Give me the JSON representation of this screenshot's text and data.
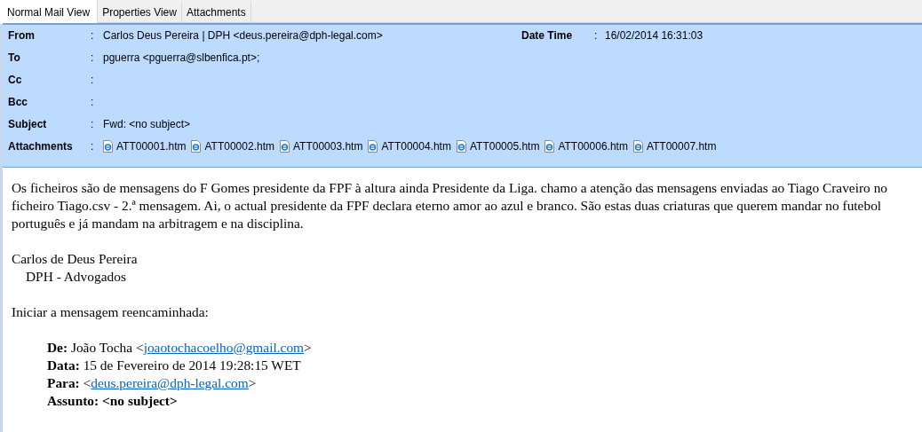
{
  "tabs": [
    {
      "label": "Normal Mail View",
      "selected": true
    },
    {
      "label": "Properties View",
      "selected": false
    },
    {
      "label": "Attachments",
      "selected": false
    }
  ],
  "header": {
    "fields": [
      {
        "kind": "text",
        "label": "From",
        "separator": ":",
        "value": "Carlos Deus Pereira | DPH <deus.pereira@dph-legal.com>"
      },
      {
        "kind": "text",
        "label": "To",
        "separator": ":",
        "value": "pguerra <pguerra@slbenfica.pt>;"
      },
      {
        "kind": "text",
        "label": "Cc",
        "separator": ":"
      },
      {
        "kind": "text",
        "label": "Bcc",
        "separator": ":"
      },
      {
        "kind": "text",
        "label": "Subject",
        "separator": ":",
        "value": "Fwd: <no subject>"
      },
      {
        "kind": "files",
        "label": "Attachments",
        "separator": ":",
        "files": [
          "ATT00001.htm",
          "ATT00002.htm",
          "ATT00003.htm",
          "ATT00004.htm",
          "ATT00005.htm",
          "ATT00006.htm",
          "ATT00007.htm"
        ]
      }
    ],
    "date_time": {
      "label": "Date Time",
      "separator": ":",
      "value": "16/02/2014 16:31:03"
    }
  },
  "body": {
    "paragraphs": [
      "Os ficheiros são de mensagens do F Gomes presidente da FPF à altura ainda Presidente da Liga. chamo a atenção das mensagens enviadas ao Tiago Craveiro no ficheiro Tiago.csv - 2.ª mensagem. Ai, o actual presidente da FPF declara eterno amor ao azul e branco. São estas duas criaturas que querem mandar no futebol português e já mandam na arbitragem e na disciplina."
    ],
    "signature": [
      "Carlos de Deus Pereira",
      "DPH - Advogados"
    ],
    "forward_intro": "Iniciar a mensagem reencaminhada:",
    "forwarded_headers": [
      {
        "label": "De:",
        "bold": false,
        "value": "João Tocha <",
        "link": "joaotochacoelho@gmail.com",
        "after": ">"
      },
      {
        "label": "Data:",
        "bold": false,
        "value": "15 de Fevereiro de 2014 19:28:15 WET"
      },
      {
        "label": "Para:",
        "bold": false,
        "value": "<",
        "link": "deus.pereira@dph-legal.com",
        "after": ">"
      },
      {
        "label": "Assunto:",
        "value": "<no subject>",
        "bold": true
      }
    ]
  }
}
